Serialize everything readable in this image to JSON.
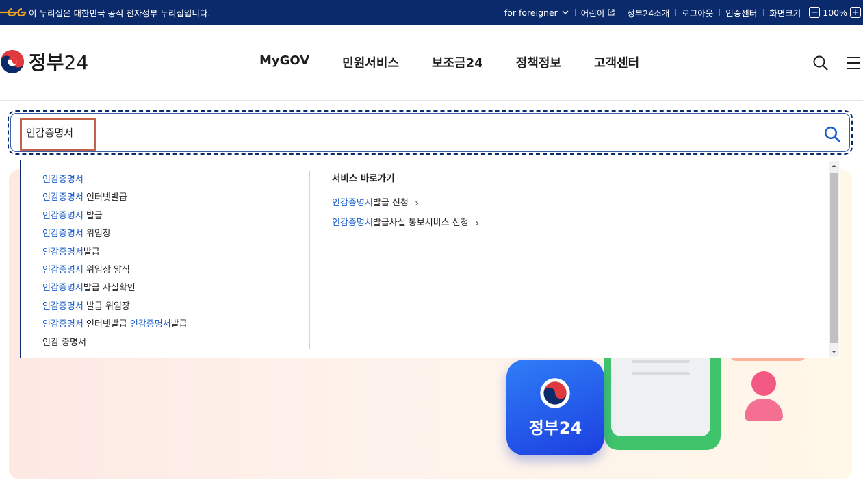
{
  "topbar": {
    "notice": "이 누리집은 대한민국 공식 전자정부 누리집입니다.",
    "foreigner": "for foreigner",
    "kids": "어린이",
    "about": "정부24소개",
    "logout": "로그아웃",
    "cert": "인증센터",
    "screen_size": "화면크기",
    "zoom_out": "−",
    "zoom_level": "100%",
    "zoom_in": "+"
  },
  "header": {
    "logo_text": "정부",
    "logo_num": "24",
    "nav": [
      "MyGOV",
      "민원서비스",
      "보조금24",
      "정책정보",
      "고객센터"
    ]
  },
  "search": {
    "value": "인감증명서"
  },
  "suggestions": [
    {
      "kw": "인감증명서",
      "rest": ""
    },
    {
      "kw": "인감증명서",
      "rest": " 인터넷발급"
    },
    {
      "kw": "인감증명서",
      "rest": " 발급"
    },
    {
      "kw": "인감증명서",
      "rest": " 위임장"
    },
    {
      "kw": "인감증명서",
      "rest": "발급"
    },
    {
      "kw": "인감증명서",
      "rest": " 위임장 양식"
    },
    {
      "kw": "인감증명서",
      "rest": "발급 사실확인"
    },
    {
      "kw": "인감증명서",
      "rest": " 발급 위임장"
    },
    {
      "kw": "인감증명서",
      "rest": " 인터넷발급 ",
      "kw2": "인감증명서",
      "rest2": "발급"
    },
    {
      "kw": "",
      "rest": "인감 증명서"
    }
  ],
  "shortcuts": {
    "title": "서비스 바로가기",
    "items": [
      {
        "kw": "인감증명서",
        "rest": " 발급 신청"
      },
      {
        "kw": "인감증명서",
        "rest": " 발급사실 통보서비스 신청"
      }
    ]
  },
  "hero": {
    "app_label": "정부24"
  },
  "colors": {
    "topbar_bg": "#0b2a6b",
    "keyword": "#1a5dc8",
    "highlight_box": "#c0634b"
  }
}
